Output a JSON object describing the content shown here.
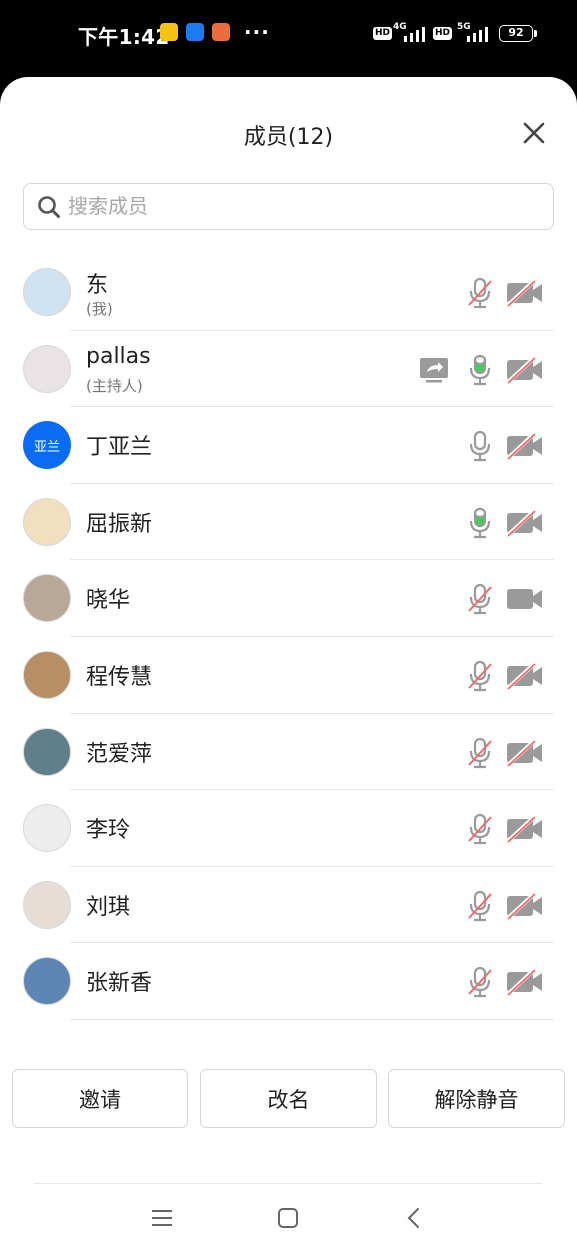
{
  "status_bar": {
    "time": "下午1:42",
    "hd1": "HD",
    "net1": "4G",
    "hd2": "HD",
    "net2": "5G",
    "battery": "92",
    "more": "···"
  },
  "sheet": {
    "title": "成员(12)",
    "search_placeholder": "搜索成员"
  },
  "members": [
    {
      "name": "东",
      "role": "(我)",
      "avatar_bg": "#cfe3f2",
      "mic": "muted",
      "cam": "off"
    },
    {
      "name": "pallas",
      "role": "(主持人)",
      "avatar_bg": "#e9e3e5",
      "mic": "active",
      "cam": "off",
      "sharing": true
    },
    {
      "name": "丁亚兰",
      "avatar_text": "亚兰",
      "avatar_bg": "#0a6cf5",
      "mic": "on",
      "cam": "off"
    },
    {
      "name": "屈振新",
      "avatar_bg": "#f1dfbf",
      "mic": "active",
      "cam": "off"
    },
    {
      "name": "晓华",
      "avatar_bg": "#b9a898",
      "mic": "muted",
      "cam": "on"
    },
    {
      "name": "程传慧",
      "avatar_bg": "#b78f62",
      "mic": "muted",
      "cam": "off"
    },
    {
      "name": "范爱萍",
      "avatar_bg": "#5f7f8a",
      "mic": "muted",
      "cam": "off"
    },
    {
      "name": "李玲",
      "avatar_bg": "#ededed",
      "mic": "muted",
      "cam": "off"
    },
    {
      "name": "刘琪",
      "avatar_bg": "#e7dcd6",
      "mic": "muted",
      "cam": "off"
    },
    {
      "name": "张新香",
      "avatar_bg": "#5d86b5",
      "mic": "muted",
      "cam": "off"
    }
  ],
  "buttons": {
    "invite": "邀请",
    "rename": "改名",
    "unmute": "解除静音"
  },
  "colors": {
    "accent_blue": "#0a6cf5",
    "mic_active": "#3fcf5a",
    "muted_red": "#f16a6a",
    "icon_grey": "#9a9a9a"
  }
}
